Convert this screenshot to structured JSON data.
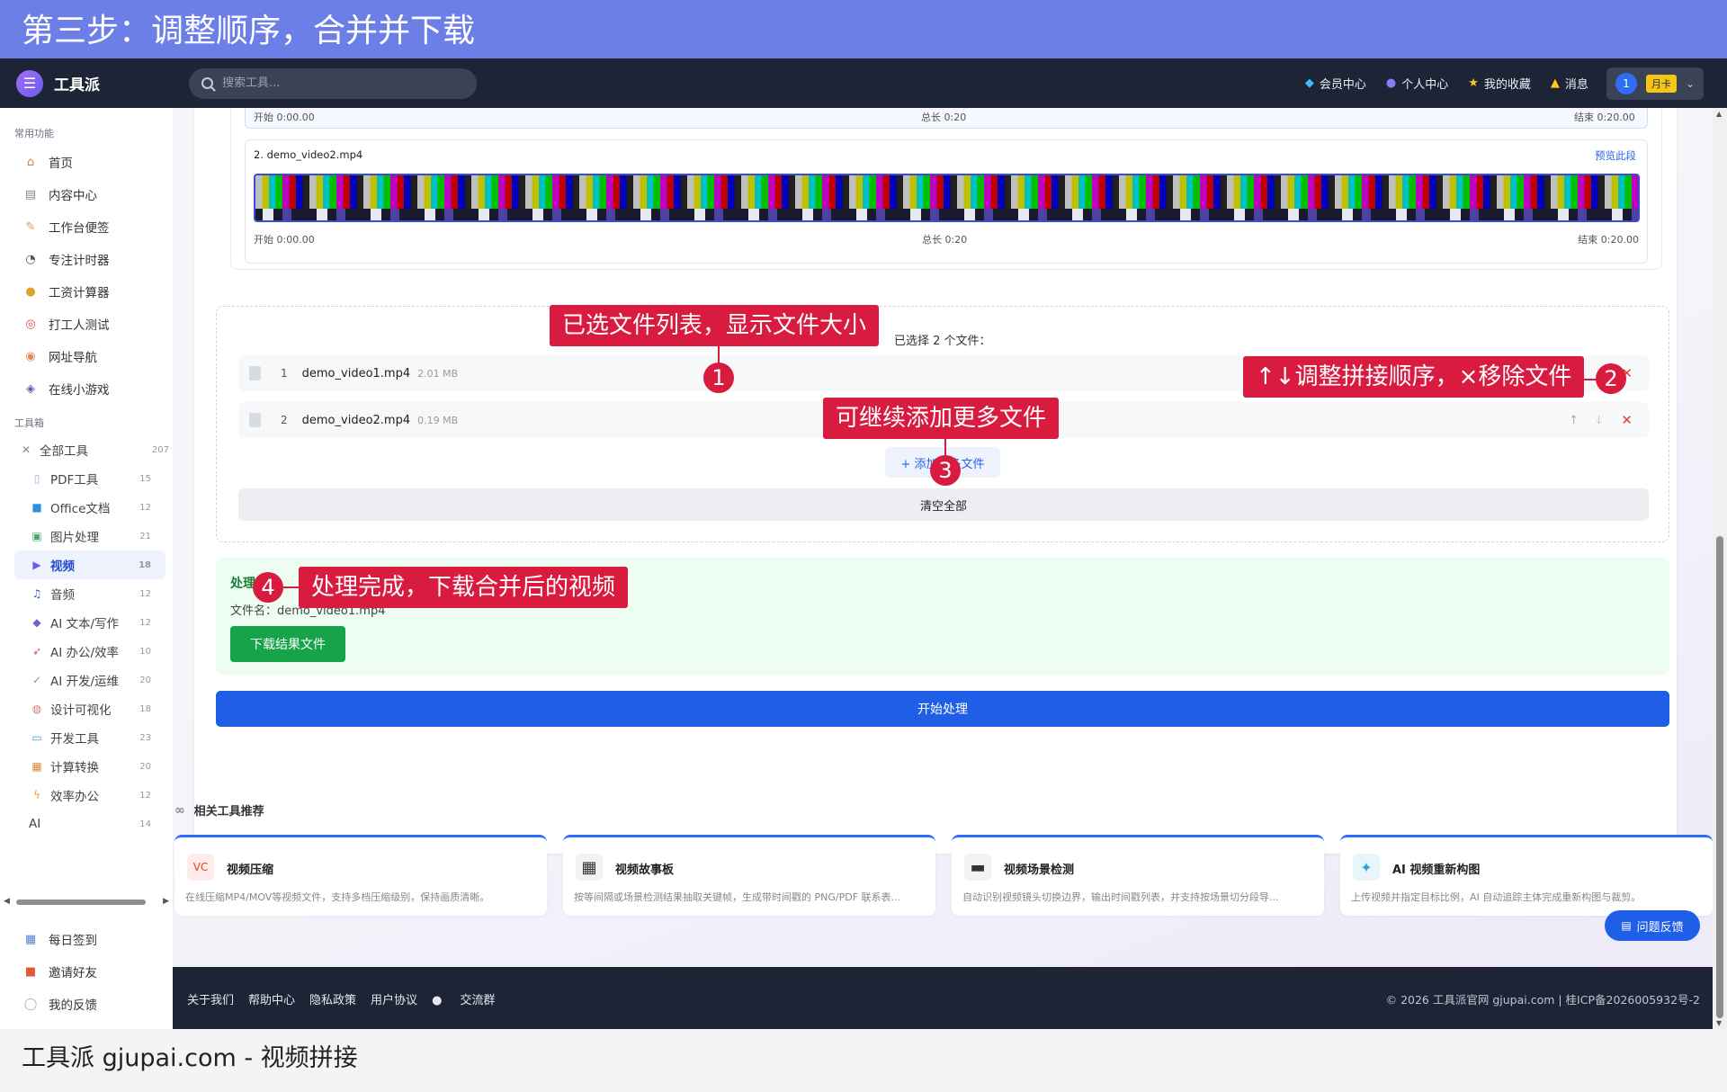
{
  "banner": {
    "title": "第三步：调整顺序，合并并下载"
  },
  "header": {
    "logo_text": "工具派",
    "search_placeholder": "搜索工具...",
    "nav": [
      "会员中心",
      "个人中心",
      "我的收藏",
      "消息"
    ],
    "user_avatar": "1",
    "badge": "月卡"
  },
  "sidebar": {
    "common_title": "常用功能",
    "common": [
      "首页",
      "内容中心",
      "工作台便签",
      "专注计时器",
      "工资计算器",
      "打工人测试",
      "网址导航",
      "在线小游戏"
    ],
    "toolbox_title": "工具箱",
    "all_tools": {
      "label": "全部工具",
      "count": "207"
    },
    "categories": [
      {
        "label": "PDF工具",
        "count": "15"
      },
      {
        "label": "Office文档",
        "count": "12"
      },
      {
        "label": "图片处理",
        "count": "21"
      },
      {
        "label": "视频",
        "count": "18"
      },
      {
        "label": "音频",
        "count": "12"
      },
      {
        "label": "AI 文本/写作",
        "count": "12"
      },
      {
        "label": "AI 办公/效率",
        "count": "10"
      },
      {
        "label": "AI 开发/运维",
        "count": "20"
      },
      {
        "label": "设计可视化",
        "count": "18"
      },
      {
        "label": "开发工具",
        "count": "23"
      },
      {
        "label": "计算转换",
        "count": "20"
      },
      {
        "label": "效率办公",
        "count": "12"
      },
      {
        "label": "AI",
        "count": "14"
      }
    ],
    "bottom": [
      "每日签到",
      "邀请好友",
      "我的反馈"
    ]
  },
  "timeline": {
    "top_start": "开始 0:00.00",
    "top_total": "总长 0:20",
    "top_end": "结束 0:20.00",
    "clip2_title": "2. demo_video2.mp4",
    "preview": "预览此段",
    "clip2_start": "开始 0:00.00",
    "clip2_total": "总长 0:20",
    "clip2_end": "结束 0:20.00"
  },
  "files": {
    "selected_label": "已选择 2 个文件：",
    "rows": [
      {
        "idx": "1",
        "name": "demo_video1.mp4",
        "size": "2.01 MB"
      },
      {
        "idx": "2",
        "name": "demo_video2.mp4",
        "size": "0.19 MB"
      }
    ],
    "up": "↑",
    "down": "↓",
    "remove": "✕",
    "add_button": "+ 添加更多文件",
    "clear_button": "清空全部"
  },
  "result": {
    "title": "处理完成",
    "filename": "文件名：demo_video1.mp4",
    "download": "下载结果文件"
  },
  "start_button": "开始处理",
  "related": {
    "title": "相关工具推荐",
    "cards": [
      {
        "title": "视频压缩",
        "desc": "在线压缩MP4/MOV等视频文件，支持多档压缩级别，保持画质清晰。",
        "icon_text": "VC",
        "color": "#e5412d"
      },
      {
        "title": "视频故事板",
        "desc": "按等间隔或场景检测结果抽取关键帧，生成带时间戳的 PNG/PDF 联系表...",
        "icon_text": "▦",
        "color": "#333333"
      },
      {
        "title": "视频场景检测",
        "desc": "自动识别视频镜头切换边界，输出时间戳列表，并支持按场景切分段导...",
        "icon_text": "▬",
        "color": "#333333"
      },
      {
        "title": "AI 视频重新构图",
        "desc": "上传视频并指定目标比例，AI 自动追踪主体完成重新构图与裁剪。",
        "icon_text": "✦",
        "color": "#2aa6e0"
      }
    ]
  },
  "feedback": "问题反馈",
  "footer": {
    "links": [
      "关于我们",
      "帮助中心",
      "隐私政策",
      "用户协议",
      "交流群"
    ],
    "copyright": "© 2026 工具派官网 gjupai.com | 桂ICP备2026005932号-2"
  },
  "bottom_caption": "工具派 gjupai.com - 视频拼接",
  "callouts": {
    "c1": "已选文件列表，显示文件大小",
    "c2": "↑↓调整拼接顺序，×移除文件",
    "c3": "可继续添加更多文件",
    "c4": "处理完成，下载合并后的视频",
    "m1": "1",
    "m2": "2",
    "m3": "3",
    "m4": "4"
  }
}
